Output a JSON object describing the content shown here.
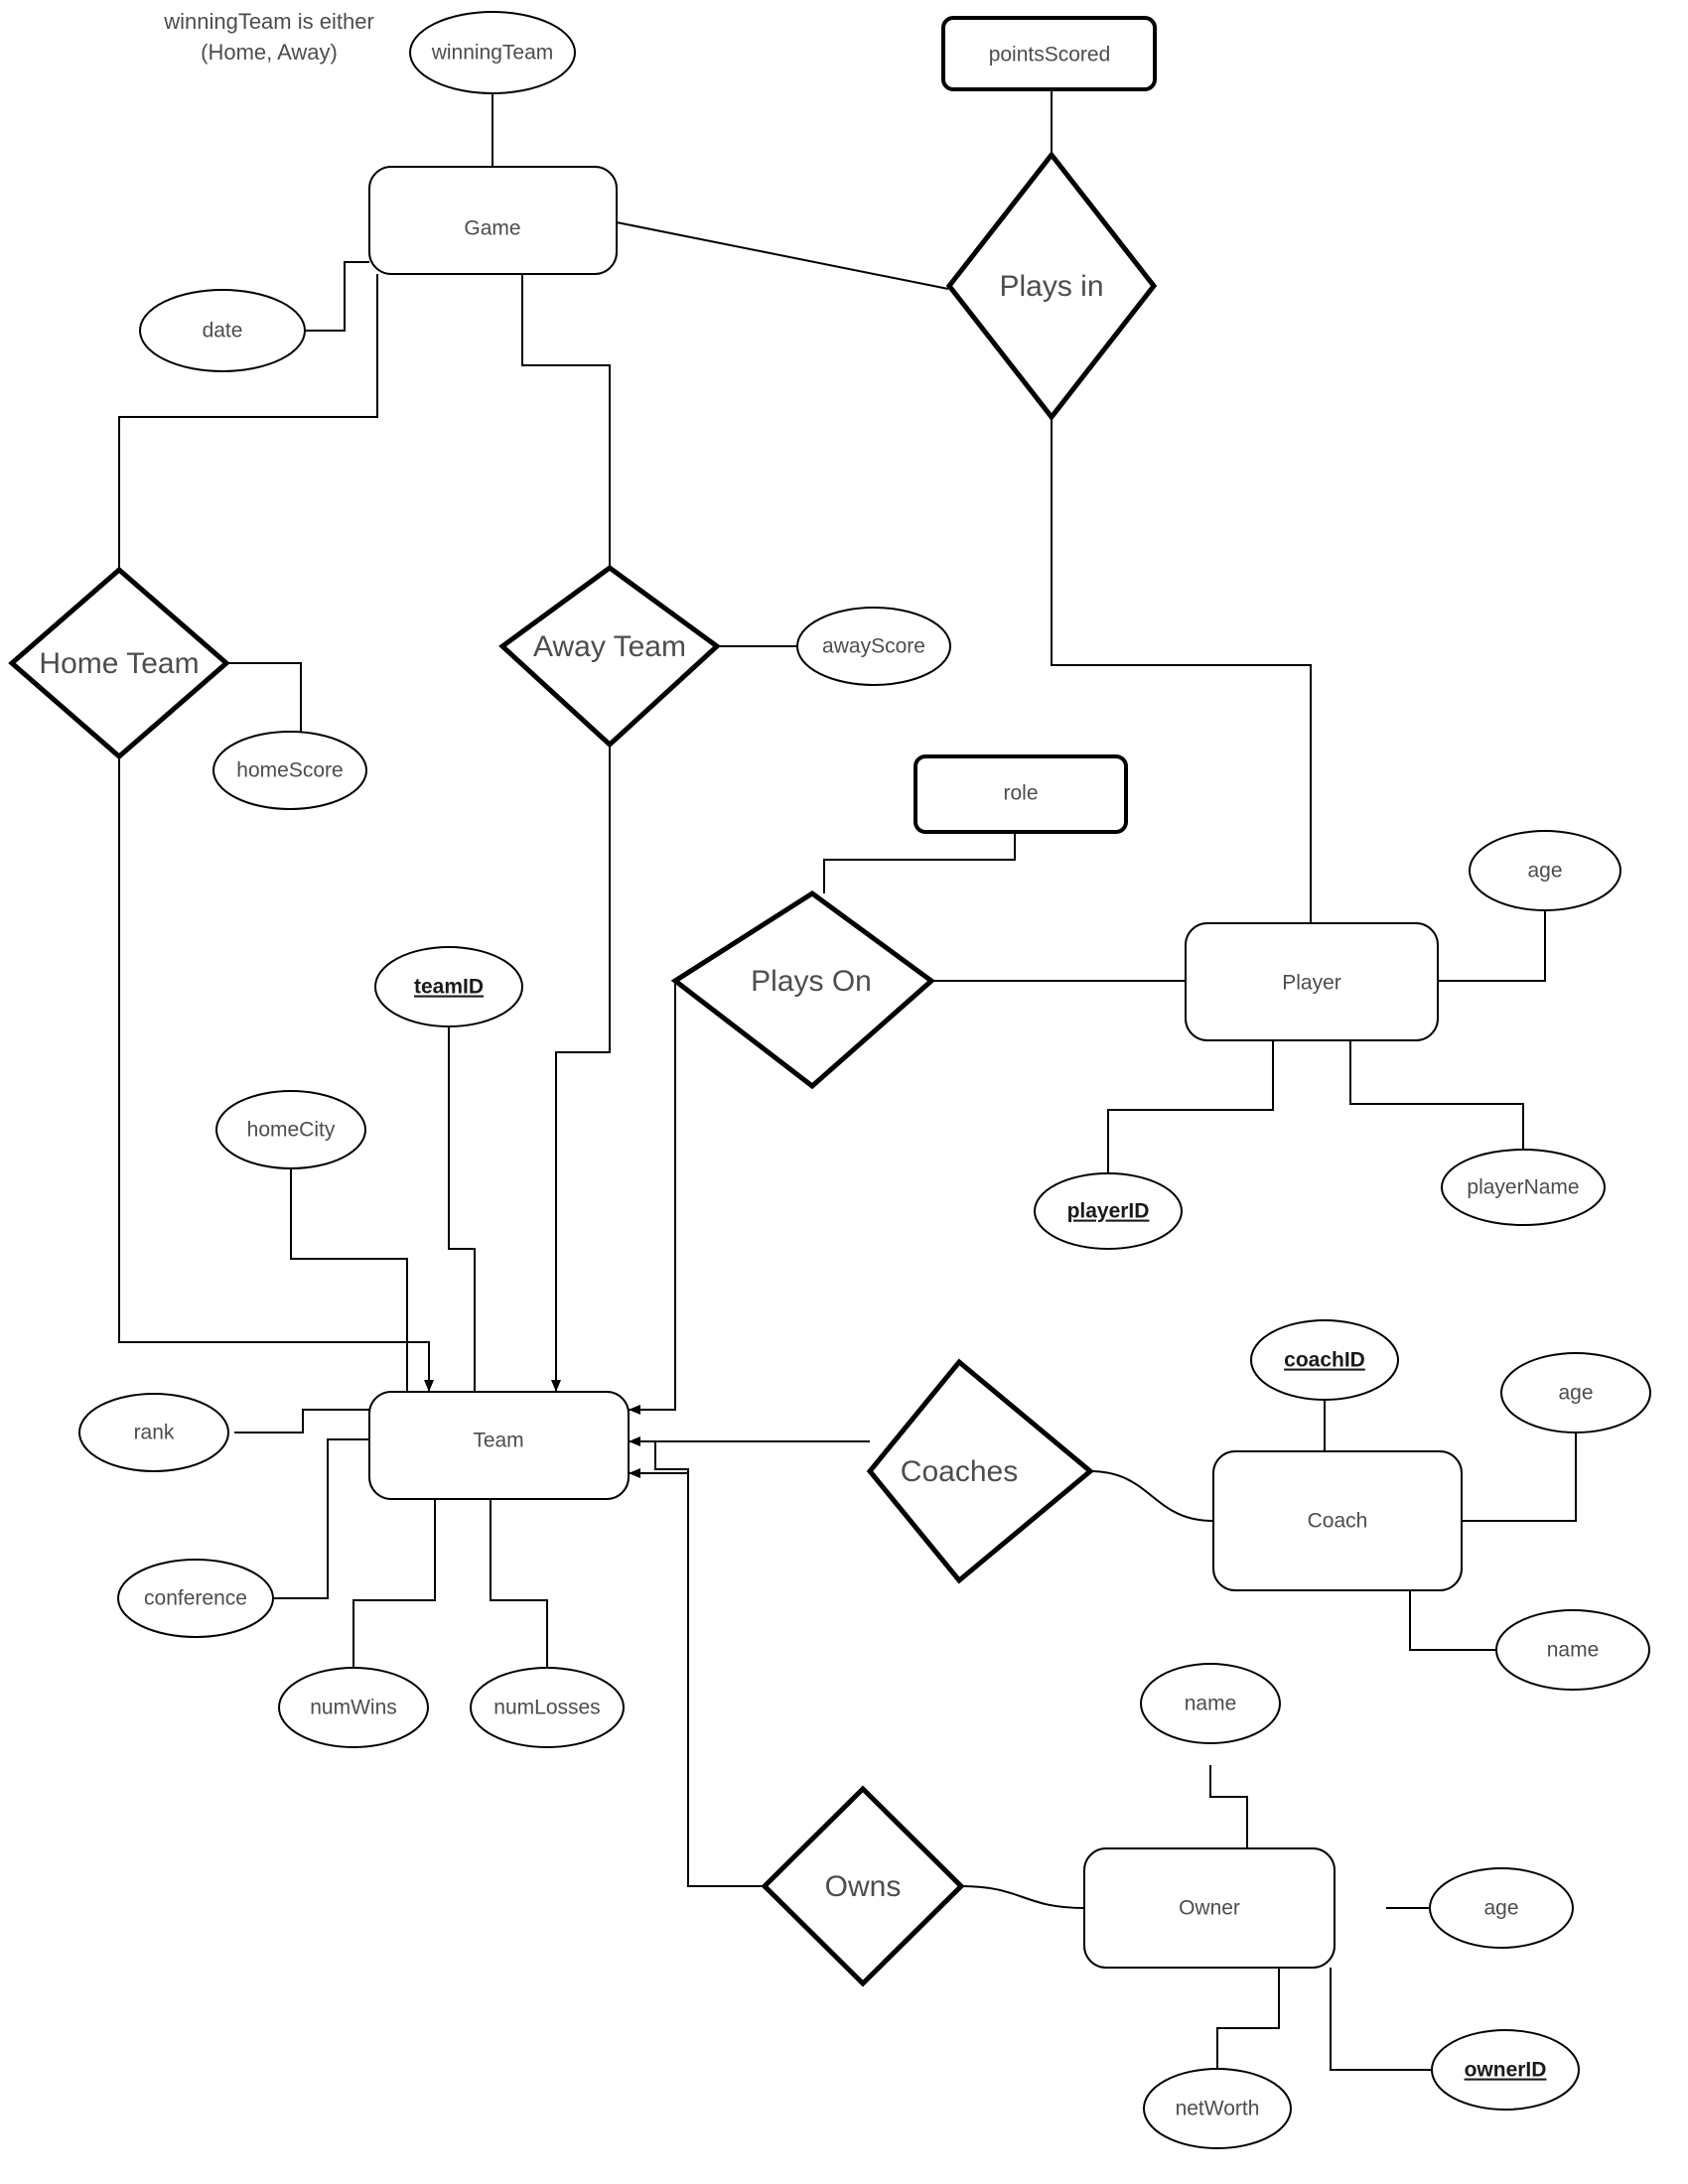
{
  "diagram": {
    "title_note": {
      "line1": "winningTeam is either",
      "line2": "(Home, Away)"
    },
    "entities": [
      {
        "id": "game",
        "label": "Game"
      },
      {
        "id": "player",
        "label": "Player"
      },
      {
        "id": "team",
        "label": "Team"
      },
      {
        "id": "coach",
        "label": "Coach"
      },
      {
        "id": "owner",
        "label": "Owner"
      }
    ],
    "relationships": [
      {
        "id": "plays_in",
        "label": "Plays in"
      },
      {
        "id": "home_team",
        "label": "Home Team"
      },
      {
        "id": "away_team",
        "label": "Away Team"
      },
      {
        "id": "plays_on",
        "label": "Plays On"
      },
      {
        "id": "coaches",
        "label": "Coaches"
      },
      {
        "id": "owns",
        "label": "Owns"
      }
    ],
    "relationship_attributes": [
      {
        "id": "pointsScored",
        "label": "pointsScored",
        "of": "plays_in"
      },
      {
        "id": "role",
        "label": "role",
        "of": "plays_on"
      }
    ],
    "attributes": [
      {
        "id": "winningTeam",
        "label": "winningTeam",
        "of": "game",
        "key": false
      },
      {
        "id": "date",
        "label": "date",
        "of": "game",
        "key": false
      },
      {
        "id": "homeScore",
        "label": "homeScore",
        "of": "home_team",
        "key": false
      },
      {
        "id": "awayScore",
        "label": "awayScore",
        "of": "away_team",
        "key": false
      },
      {
        "id": "playerAge",
        "label": "age",
        "of": "player",
        "key": false
      },
      {
        "id": "playerID",
        "label": "playerID",
        "of": "player",
        "key": true
      },
      {
        "id": "playerName",
        "label": "playerName",
        "of": "player",
        "key": false
      },
      {
        "id": "teamID",
        "label": "teamID",
        "of": "team",
        "key": true
      },
      {
        "id": "homeCity",
        "label": "homeCity",
        "of": "team",
        "key": false
      },
      {
        "id": "rank",
        "label": "rank",
        "of": "team",
        "key": false
      },
      {
        "id": "conference",
        "label": "conference",
        "of": "team",
        "key": false
      },
      {
        "id": "numWins",
        "label": "numWins",
        "of": "team",
        "key": false
      },
      {
        "id": "numLosses",
        "label": "numLosses",
        "of": "team",
        "key": false
      },
      {
        "id": "coachID",
        "label": "coachID",
        "of": "coach",
        "key": true
      },
      {
        "id": "coachAge",
        "label": "age",
        "of": "coach",
        "key": false
      },
      {
        "id": "coachName",
        "label": "name",
        "of": "coach",
        "key": false
      },
      {
        "id": "ownerName",
        "label": "name",
        "of": "owner",
        "key": false
      },
      {
        "id": "ownerAge",
        "label": "age",
        "of": "owner",
        "key": false
      },
      {
        "id": "netWorth",
        "label": "netWorth",
        "of": "owner",
        "key": false
      },
      {
        "id": "ownerID",
        "label": "ownerID",
        "of": "owner",
        "key": true
      }
    ],
    "colors": {
      "stroke": "#000000",
      "text": "#4d4d4d",
      "background": "#ffffff"
    }
  }
}
